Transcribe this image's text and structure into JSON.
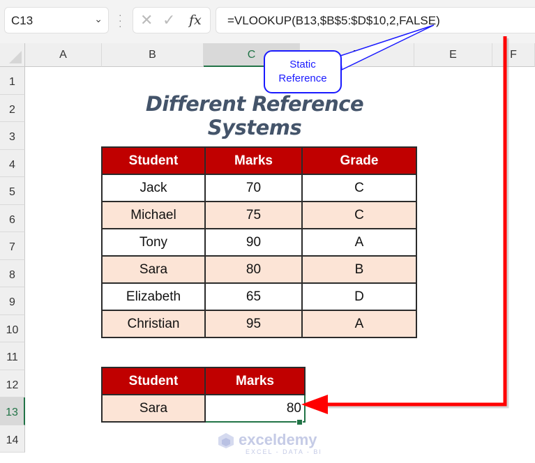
{
  "toolbar": {
    "name_box": "C13",
    "cancel_icon": "✕",
    "enter_icon": "✓",
    "fx_label": "fx",
    "formula": "=VLOOKUP(B13,$B$5:$D$10,2,FALSE)"
  },
  "columns": [
    "A",
    "B",
    "C",
    "D",
    "E",
    "F"
  ],
  "selected_column": "C",
  "rows": [
    "1",
    "2",
    "3",
    "4",
    "5",
    "6",
    "7",
    "8",
    "9",
    "10",
    "11",
    "12",
    "13",
    "14"
  ],
  "selected_row": "13",
  "sheet": {
    "title": "Different Reference Systems",
    "main_table": {
      "headers": [
        "Student",
        "Marks",
        "Grade"
      ],
      "rows": [
        [
          "Jack",
          "70",
          "C"
        ],
        [
          "Michael",
          "75",
          "C"
        ],
        [
          "Tony",
          "90",
          "A"
        ],
        [
          "Sara",
          "80",
          "B"
        ],
        [
          "Elizabeth",
          "65",
          "D"
        ],
        [
          "Christian",
          "95",
          "A"
        ]
      ]
    },
    "lookup_table": {
      "headers": [
        "Student",
        "Marks"
      ],
      "row": [
        "Sara",
        "80"
      ]
    }
  },
  "annotation": {
    "callout_line1": "Static",
    "callout_line2": "Reference",
    "arrow_color": "#ff0000",
    "callout_color": "#1a1aff"
  },
  "colors": {
    "header_red": "#c00000",
    "alt_row": "#fce4d6",
    "title": "#44546a",
    "selection_green": "#217346"
  },
  "watermark": {
    "name": "exceldemy",
    "tagline": "EXCEL - DATA - BI"
  }
}
